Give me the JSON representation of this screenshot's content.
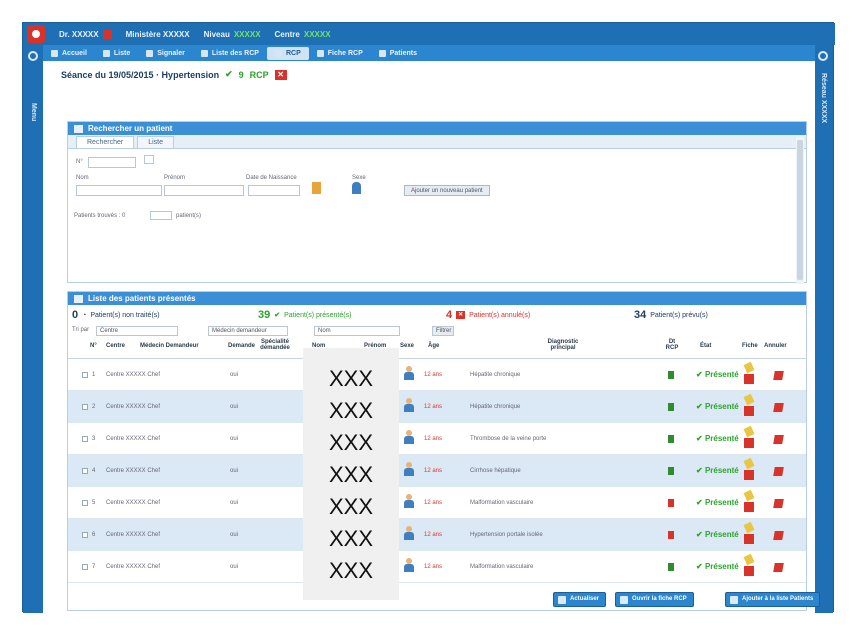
{
  "header": {
    "user": "Dr. XXXXX",
    "ministry": "Ministère XXXXX",
    "level_label": "Niveau",
    "level_value": "XXXXX",
    "center_label": "Centre",
    "center_value": "XXXXX"
  },
  "nav": {
    "tabs": [
      {
        "label": "Accueil",
        "icon": "home-icon"
      },
      {
        "label": "Liste",
        "icon": "list-icon"
      },
      {
        "label": "Signaler",
        "icon": "signal-icon"
      },
      {
        "label": "Liste des RCP",
        "icon": "folder-icon"
      },
      {
        "label": "RCP",
        "icon": "rcp-icon"
      },
      {
        "label": "Fiche RCP",
        "icon": "file-icon"
      },
      {
        "label": "Patients",
        "icon": "users-icon"
      }
    ]
  },
  "rails": {
    "left": "Menu",
    "right": "Réseau XXXXX"
  },
  "page": {
    "title": "Séance du 19/05/2015 · Hypertension",
    "count_ok": "9",
    "count_label": "RCP",
    "count_x": ""
  },
  "search": {
    "title": "Rechercher un patient",
    "tab_1": "Rechercher",
    "tab_2": "Liste",
    "id_label": "N°",
    "nom_label": "Nom",
    "prenom_label": "Prénom",
    "date_label": "Date de Naissance",
    "sexe_label": "Sexe",
    "add_button": "Ajouter un nouveau patient",
    "found_label": "Patients trouvés : 0",
    "found_suffix": "patient(s)"
  },
  "list": {
    "title": "Liste des patients présentés",
    "summary": {
      "pending_count": "0",
      "pending_label": "Patient(s) non traité(s)",
      "done_count": "39",
      "done_label": "Patient(s) présenté(s)",
      "rejected_count": "4",
      "rejected_label": "Patient(s) annulé(s)",
      "total_count": "34",
      "total_label": "Patient(s) prévu(s)"
    },
    "filters": {
      "tri_label": "Tri par",
      "tri_value": "Centre",
      "f2_value": "Médecin demandeur",
      "f3_value": "Nom",
      "go_button": "Filtrer"
    },
    "columns": [
      "N°",
      "Centre",
      "Médecin Demandeur",
      "Demande",
      "Spécialité demandée",
      "Nom",
      "Prénom",
      "Sexe",
      "Âge",
      "Diagnostic principal",
      "Dt RCP",
      "État",
      "Fiche",
      "Annuler"
    ],
    "rows": [
      {
        "num": "1",
        "centre": "Centre XXXXX Chef",
        "demande": "oui",
        "age": "12 ans",
        "diag": "Hépatite chronique",
        "etat": "Présenté",
        "alt": false,
        "doc_color": "#2e8b2e"
      },
      {
        "num": "2",
        "centre": "Centre XXXXX Chef",
        "demande": "oui",
        "age": "12 ans",
        "diag": "Hépatite chronique",
        "etat": "Présenté",
        "alt": true,
        "doc_color": "#2e8b2e"
      },
      {
        "num": "3",
        "centre": "Centre XXXXX Chef",
        "demande": "oui",
        "age": "12 ans",
        "diag": "Thrombose de la veine porte",
        "etat": "Présenté",
        "alt": false,
        "doc_color": "#2e8b2e"
      },
      {
        "num": "4",
        "centre": "Centre XXXXX Chef",
        "demande": "oui",
        "age": "12 ans",
        "diag": "Cirrhose hépatique",
        "etat": "Présenté",
        "alt": true,
        "doc_color": "#2e8b2e"
      },
      {
        "num": "5",
        "centre": "Centre XXXXX Chef",
        "demande": "oui",
        "age": "12 ans",
        "diag": "Malformation vasculaire",
        "etat": "Présenté",
        "alt": false,
        "doc_color": "#d9322a"
      },
      {
        "num": "6",
        "centre": "Centre XXXXX Chef",
        "demande": "oui",
        "age": "12 ans",
        "diag": "Hypertension portale isolée",
        "etat": "Présenté",
        "alt": true,
        "doc_color": "#d9322a"
      },
      {
        "num": "7",
        "centre": "Centre XXXXX Chef",
        "demande": "oui",
        "age": "12 ans",
        "diag": "Malformation vasculaire",
        "etat": "Présenté",
        "alt": false,
        "doc_color": "#2e8b2e"
      }
    ],
    "anonymized": [
      "XXX",
      "XXX",
      "XXX",
      "XXX",
      "XXX",
      "XXX",
      "XXX"
    ]
  },
  "footer": {
    "btn_refresh": "Actualiser",
    "btn_fiche": "Ouvrir la fiche RCP",
    "btn_add": "Ajouter à la liste Patients"
  }
}
